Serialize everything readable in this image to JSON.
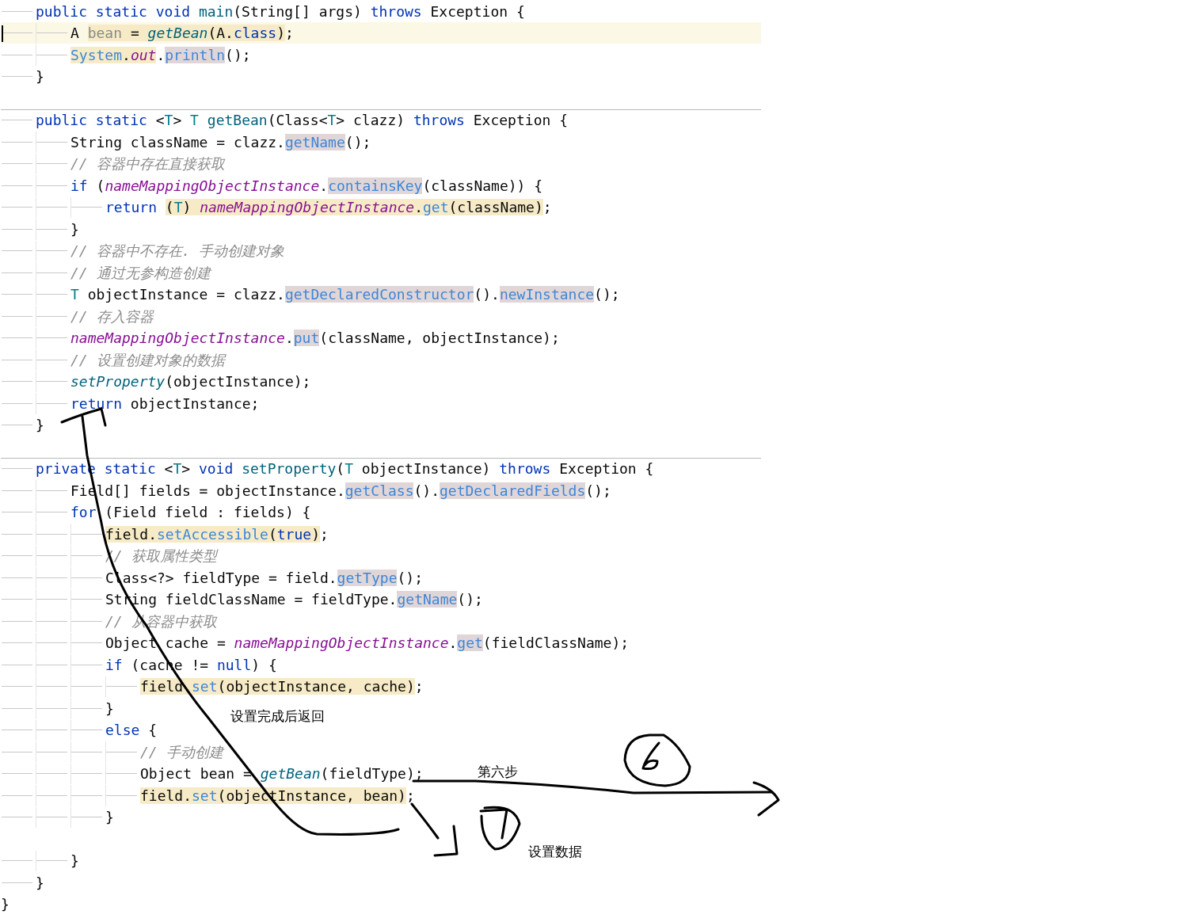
{
  "editor": {
    "lines": [
      {
        "kind": "scope",
        "children": [
          {
            "kind": "code",
            "current": false,
            "separator_above": false,
            "tokens": [
              {
                "text": "public static void ",
                "kind": "keyword"
              },
              {
                "text": "main",
                "kind": "declaration"
              },
              {
                "text": "(String[] args) ",
                "kind": "plain"
              },
              {
                "text": "throws",
                "kind": "keyword"
              },
              {
                "text": " Exception {",
                "kind": "plain"
              }
            ],
            "children": [
              {
                "kind": "code",
                "current": true,
                "separator_above": false,
                "tokens": [
                  {
                    "text": "A ",
                    "kind": "plain"
                  },
                  {
                    "text": "bean",
                    "kind": "unused",
                    "color": "#f6ebc6"
                  },
                  {
                    "text": " = ",
                    "kind": "plain",
                    "color": "#f6ebc6"
                  },
                  {
                    "text": "getBean",
                    "kind": "static_call",
                    "color": "#f6ebc6"
                  },
                  {
                    "text": "(A.",
                    "kind": "plain",
                    "color": "#f6ebc6"
                  },
                  {
                    "text": "class",
                    "kind": "keyword",
                    "color": "#f6ebc6"
                  },
                  {
                    "text": ")",
                    "kind": "plain",
                    "color": "#f6ebc6"
                  },
                  {
                    "text": ";",
                    "kind": "plain"
                  }
                ]
              },
              {
                "kind": "code",
                "current": false,
                "separator_above": false,
                "tokens": [
                  {
                    "text": "System",
                    "kind": "call",
                    "color": "#f6ebc6"
                  },
                  {
                    "text": ".",
                    "kind": "plain",
                    "color": "#f6ebc6"
                  },
                  {
                    "text": "out",
                    "kind": "static_field",
                    "color": "#f6ebc6"
                  },
                  {
                    "text": ".",
                    "kind": "plain"
                  },
                  {
                    "text": "println",
                    "kind": "call",
                    "color": "#e0d6d8"
                  },
                  {
                    "text": "();",
                    "kind": "plain"
                  }
                ]
              }
            ]
          },
          {
            "kind": "code",
            "current": false,
            "separator_above": false,
            "tokens": [
              {
                "text": "}",
                "kind": "plain"
              }
            ]
          },
          {
            "kind": "blank",
            "current": false,
            "separator_above": false
          },
          {
            "kind": "code",
            "current": false,
            "separator_above": true,
            "tokens": [
              {
                "text": "public static",
                "kind": "keyword"
              },
              {
                "text": " <",
                "kind": "plain"
              },
              {
                "text": "T",
                "kind": "type_param"
              },
              {
                "text": "> ",
                "kind": "plain"
              },
              {
                "text": "T ",
                "kind": "type_param"
              },
              {
                "text": "getBean",
                "kind": "declaration"
              },
              {
                "text": "(Class<",
                "kind": "plain"
              },
              {
                "text": "T",
                "kind": "type_param"
              },
              {
                "text": "> clazz) ",
                "kind": "plain"
              },
              {
                "text": "throws",
                "kind": "keyword"
              },
              {
                "text": " Exception {",
                "kind": "plain"
              }
            ],
            "children": [
              {
                "kind": "code",
                "current": false,
                "separator_above": false,
                "tokens": [
                  {
                    "text": "String className = clazz.",
                    "kind": "plain"
                  },
                  {
                    "text": "getName",
                    "kind": "call",
                    "color": "#e0d6d8"
                  },
                  {
                    "text": "();",
                    "kind": "plain"
                  }
                ]
              },
              {
                "kind": "code",
                "current": false,
                "separator_above": false,
                "tokens": [
                  {
                    "text": "// 容器中存在直接获取",
                    "kind": "comment"
                  }
                ]
              },
              {
                "kind": "code",
                "current": false,
                "separator_above": false,
                "tokens": [
                  {
                    "text": "if",
                    "kind": "keyword"
                  },
                  {
                    "text": " (",
                    "kind": "plain"
                  },
                  {
                    "text": "nameMappingObjectInstance",
                    "kind": "static_field"
                  },
                  {
                    "text": ".",
                    "kind": "plain"
                  },
                  {
                    "text": "containsKey",
                    "kind": "call",
                    "color": "#e0d6d8"
                  },
                  {
                    "text": "(className)) {",
                    "kind": "plain"
                  }
                ],
                "children": [
                  {
                    "kind": "code",
                    "current": false,
                    "separator_above": false,
                    "tokens": [
                      {
                        "text": "return ",
                        "kind": "keyword"
                      },
                      {
                        "text": "(",
                        "kind": "plain",
                        "color": "#f6ebc6"
                      },
                      {
                        "text": "T",
                        "kind": "type_param",
                        "color": "#f6ebc6"
                      },
                      {
                        "text": ") ",
                        "kind": "plain",
                        "color": "#f6ebc6"
                      },
                      {
                        "text": "nameMappingObjectInstance",
                        "kind": "static_field",
                        "color": "#f6ebc6"
                      },
                      {
                        "text": ".",
                        "kind": "plain",
                        "color": "#f6ebc6"
                      },
                      {
                        "text": "get",
                        "kind": "call",
                        "color": "#f6ebc6"
                      },
                      {
                        "text": "(className)",
                        "kind": "plain",
                        "color": "#f6ebc6"
                      },
                      {
                        "text": ";",
                        "kind": "plain"
                      }
                    ]
                  }
                ]
              },
              {
                "kind": "code",
                "current": false,
                "separator_above": false,
                "tokens": [
                  {
                    "text": "}",
                    "kind": "plain"
                  }
                ]
              },
              {
                "kind": "code",
                "current": false,
                "separator_above": false,
                "tokens": [
                  {
                    "text": "// 容器中不存在. 手动创建对象",
                    "kind": "comment"
                  }
                ]
              },
              {
                "kind": "code",
                "current": false,
                "separator_above": false,
                "tokens": [
                  {
                    "text": "// 通过无参构造创建",
                    "kind": "comment"
                  }
                ]
              },
              {
                "kind": "code",
                "current": false,
                "separator_above": false,
                "tokens": [
                  {
                    "text": "T",
                    "kind": "type_param"
                  },
                  {
                    "text": " objectInstance = clazz.",
                    "kind": "plain"
                  },
                  {
                    "text": "getDeclaredConstructor",
                    "kind": "call",
                    "color": "#e0d6d8"
                  },
                  {
                    "text": "().",
                    "kind": "plain"
                  },
                  {
                    "text": "newInstance",
                    "kind": "call",
                    "color": "#e0d6d8"
                  },
                  {
                    "text": "();",
                    "kind": "plain"
                  }
                ]
              },
              {
                "kind": "code",
                "current": false,
                "separator_above": false,
                "tokens": [
                  {
                    "text": "// 存入容器",
                    "kind": "comment"
                  }
                ]
              },
              {
                "kind": "code",
                "current": false,
                "separator_above": false,
                "tokens": [
                  {
                    "text": "nameMappingObjectInstance",
                    "kind": "static_field"
                  },
                  {
                    "text": ".",
                    "kind": "plain"
                  },
                  {
                    "text": "put",
                    "kind": "call",
                    "color": "#e0d6d8"
                  },
                  {
                    "text": "(className, objectInstance);",
                    "kind": "plain"
                  }
                ]
              },
              {
                "kind": "code",
                "current": false,
                "separator_above": false,
                "tokens": [
                  {
                    "text": "// 设置创建对象的数据",
                    "kind": "comment"
                  }
                ]
              },
              {
                "kind": "code",
                "current": false,
                "separator_above": false,
                "tokens": [
                  {
                    "text": "setProperty",
                    "kind": "static_call"
                  },
                  {
                    "text": "(objectInstance);",
                    "kind": "plain"
                  }
                ]
              },
              {
                "kind": "code",
                "current": false,
                "separator_above": false,
                "tokens": [
                  {
                    "text": "return",
                    "kind": "keyword"
                  },
                  {
                    "text": " objectInstance;",
                    "kind": "plain"
                  }
                ]
              }
            ]
          },
          {
            "kind": "code",
            "current": false,
            "separator_above": false,
            "tokens": [
              {
                "text": "}",
                "kind": "plain"
              }
            ]
          },
          {
            "kind": "blank",
            "current": false,
            "separator_above": false
          },
          {
            "kind": "code",
            "current": false,
            "separator_above": true,
            "tokens": [
              {
                "text": "private static",
                "kind": "keyword"
              },
              {
                "text": " <",
                "kind": "plain"
              },
              {
                "text": "T",
                "kind": "type_param"
              },
              {
                "text": "> ",
                "kind": "plain"
              },
              {
                "text": "void ",
                "kind": "keyword"
              },
              {
                "text": "setProperty",
                "kind": "declaration"
              },
              {
                "text": "(",
                "kind": "plain"
              },
              {
                "text": "T",
                "kind": "type_param"
              },
              {
                "text": " objectInstance) ",
                "kind": "plain"
              },
              {
                "text": "throws",
                "kind": "keyword"
              },
              {
                "text": " Exception {",
                "kind": "plain"
              }
            ],
            "children": [
              {
                "kind": "code",
                "current": false,
                "separator_above": false,
                "tokens": [
                  {
                    "text": "Field[] fields = objectInstance.",
                    "kind": "plain"
                  },
                  {
                    "text": "getClass",
                    "kind": "call",
                    "color": "#e0d6d8"
                  },
                  {
                    "text": "().",
                    "kind": "plain"
                  },
                  {
                    "text": "getDeclaredFields",
                    "kind": "call",
                    "color": "#e0d6d8"
                  },
                  {
                    "text": "();",
                    "kind": "plain"
                  }
                ]
              },
              {
                "kind": "code",
                "current": false,
                "separator_above": false,
                "tokens": [
                  {
                    "text": "for",
                    "kind": "keyword"
                  },
                  {
                    "text": " (Field field : fields) {",
                    "kind": "plain"
                  }
                ],
                "children": [
                  {
                    "kind": "code",
                    "current": false,
                    "separator_above": false,
                    "tokens": [
                      {
                        "text": "field.",
                        "kind": "plain",
                        "color": "#f6ebc6"
                      },
                      {
                        "text": "setAccessible",
                        "kind": "call",
                        "color": "#f6ebc6"
                      },
                      {
                        "text": "(",
                        "kind": "plain",
                        "color": "#f6ebc6"
                      },
                      {
                        "text": "true",
                        "kind": "keyword",
                        "color": "#f6ebc6"
                      },
                      {
                        "text": ")",
                        "kind": "plain",
                        "color": "#f6ebc6"
                      },
                      {
                        "text": ";",
                        "kind": "plain"
                      }
                    ]
                  },
                  {
                    "kind": "code",
                    "current": false,
                    "separator_above": false,
                    "tokens": [
                      {
                        "text": "// 获取属性类型",
                        "kind": "comment"
                      }
                    ]
                  },
                  {
                    "kind": "code",
                    "current": false,
                    "separator_above": false,
                    "tokens": [
                      {
                        "text": "Class<?> fieldType = field.",
                        "kind": "plain"
                      },
                      {
                        "text": "getType",
                        "kind": "call",
                        "color": "#e0d6d8"
                      },
                      {
                        "text": "();",
                        "kind": "plain"
                      }
                    ]
                  },
                  {
                    "kind": "code",
                    "current": false,
                    "separator_above": false,
                    "tokens": [
                      {
                        "text": "String fieldClassName = fieldType.",
                        "kind": "plain"
                      },
                      {
                        "text": "getName",
                        "kind": "call",
                        "color": "#e0d6d8"
                      },
                      {
                        "text": "();",
                        "kind": "plain"
                      }
                    ]
                  },
                  {
                    "kind": "code",
                    "current": false,
                    "separator_above": false,
                    "tokens": [
                      {
                        "text": "// 从容器中获取",
                        "kind": "comment"
                      }
                    ]
                  },
                  {
                    "kind": "code",
                    "current": false,
                    "separator_above": false,
                    "tokens": [
                      {
                        "text": "Object cache = ",
                        "kind": "plain"
                      },
                      {
                        "text": "nameMappingObjectInstance",
                        "kind": "static_field"
                      },
                      {
                        "text": ".",
                        "kind": "plain"
                      },
                      {
                        "text": "get",
                        "kind": "call",
                        "color": "#e0d6d8"
                      },
                      {
                        "text": "(fieldClassName);",
                        "kind": "plain"
                      }
                    ]
                  },
                  {
                    "kind": "code",
                    "current": false,
                    "separator_above": false,
                    "tokens": [
                      {
                        "text": "if",
                        "kind": "keyword"
                      },
                      {
                        "text": " (cache != ",
                        "kind": "plain"
                      },
                      {
                        "text": "null",
                        "kind": "keyword"
                      },
                      {
                        "text": ") {",
                        "kind": "plain"
                      }
                    ],
                    "children": [
                      {
                        "kind": "code",
                        "current": false,
                        "separator_above": false,
                        "tokens": [
                          {
                            "text": "field.",
                            "kind": "plain",
                            "color": "#f6ebc6"
                          },
                          {
                            "text": "set",
                            "kind": "call",
                            "color": "#f6ebc6"
                          },
                          {
                            "text": "(objectInstance, cache)",
                            "kind": "plain",
                            "color": "#f6ebc6"
                          },
                          {
                            "text": ";",
                            "kind": "plain"
                          }
                        ]
                      }
                    ]
                  },
                  {
                    "kind": "code",
                    "current": false,
                    "separator_above": false,
                    "tokens": [
                      {
                        "text": "}",
                        "kind": "plain"
                      }
                    ]
                  },
                  {
                    "kind": "code",
                    "current": false,
                    "separator_above": false,
                    "tokens": [
                      {
                        "text": "else",
                        "kind": "keyword"
                      },
                      {
                        "text": " {",
                        "kind": "plain"
                      }
                    ],
                    "children": [
                      {
                        "kind": "code",
                        "current": false,
                        "separator_above": false,
                        "tokens": [
                          {
                            "text": "// 手动创建",
                            "kind": "comment"
                          }
                        ]
                      },
                      {
                        "kind": "code",
                        "current": false,
                        "separator_above": false,
                        "tokens": [
                          {
                            "text": "Object bean = ",
                            "kind": "plain"
                          },
                          {
                            "text": "getBean",
                            "kind": "static_call"
                          },
                          {
                            "text": "(fieldType);",
                            "kind": "plain"
                          }
                        ]
                      },
                      {
                        "kind": "code",
                        "current": false,
                        "separator_above": false,
                        "tokens": [
                          {
                            "text": "field.",
                            "kind": "plain",
                            "color": "#f6ebc6"
                          },
                          {
                            "text": "set",
                            "kind": "call",
                            "color": "#f6ebc6"
                          },
                          {
                            "text": "(objectInstance, bean)",
                            "kind": "plain",
                            "color": "#f6ebc6"
                          },
                          {
                            "text": ";",
                            "kind": "plain"
                          }
                        ]
                      }
                    ]
                  },
                  {
                    "kind": "code",
                    "current": false,
                    "separator_above": false,
                    "tokens": [
                      {
                        "text": "}",
                        "kind": "plain"
                      }
                    ]
                  },
                  {
                    "kind": "blank",
                    "current": false,
                    "separator_above": false
                  }
                ]
              },
              {
                "kind": "code",
                "current": false,
                "separator_above": false,
                "tokens": [
                  {
                    "text": "}",
                    "kind": "plain"
                  }
                ]
              }
            ]
          },
          {
            "kind": "code",
            "current": false,
            "separator_above": false,
            "tokens": [
              {
                "text": "}",
                "kind": "plain"
              }
            ]
          }
        ]
      },
      {
        "kind": "code",
        "current": false,
        "separator_above": false,
        "tokens": [
          {
            "text": "}",
            "kind": "plain"
          }
        ]
      }
    ]
  },
  "annotations": [
    {
      "text": "设置完成后返回"
    },
    {
      "text": "第六步"
    },
    {
      "text": "设置数据"
    }
  ]
}
